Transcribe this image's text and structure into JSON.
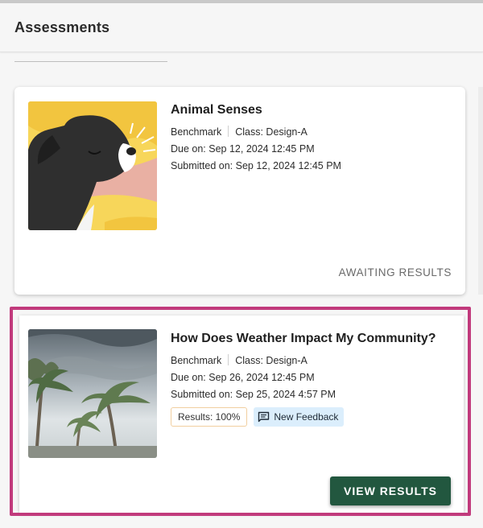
{
  "header": {
    "title": "Assessments"
  },
  "assessments": [
    {
      "title": "Animal Senses",
      "type": "Benchmark",
      "class": "Class: Design-A",
      "due": "Due on: Sep 12, 2024 12:45 PM",
      "submitted": "Submitted on: Sep 12, 2024 12:45 PM",
      "status": "AWAITING RESULTS",
      "thumbnail": "dog-illustration"
    },
    {
      "title": "How Does Weather Impact My Community?",
      "type": "Benchmark",
      "class": "Class: Design-A",
      "due": "Due on: Sep 26, 2024 12:45 PM",
      "submitted": "Submitted on: Sep 25, 2024 4:57 PM",
      "results": "Results: 100%",
      "feedback": "New Feedback",
      "button": "VIEW RESULTS",
      "thumbnail": "stormy-palm-trees"
    }
  ],
  "colors": {
    "primary_button": "#22573f",
    "highlight_border": "#c13a7c",
    "feedback_chip_bg": "#dbeefc",
    "results_chip_border": "#f1cfa0"
  }
}
